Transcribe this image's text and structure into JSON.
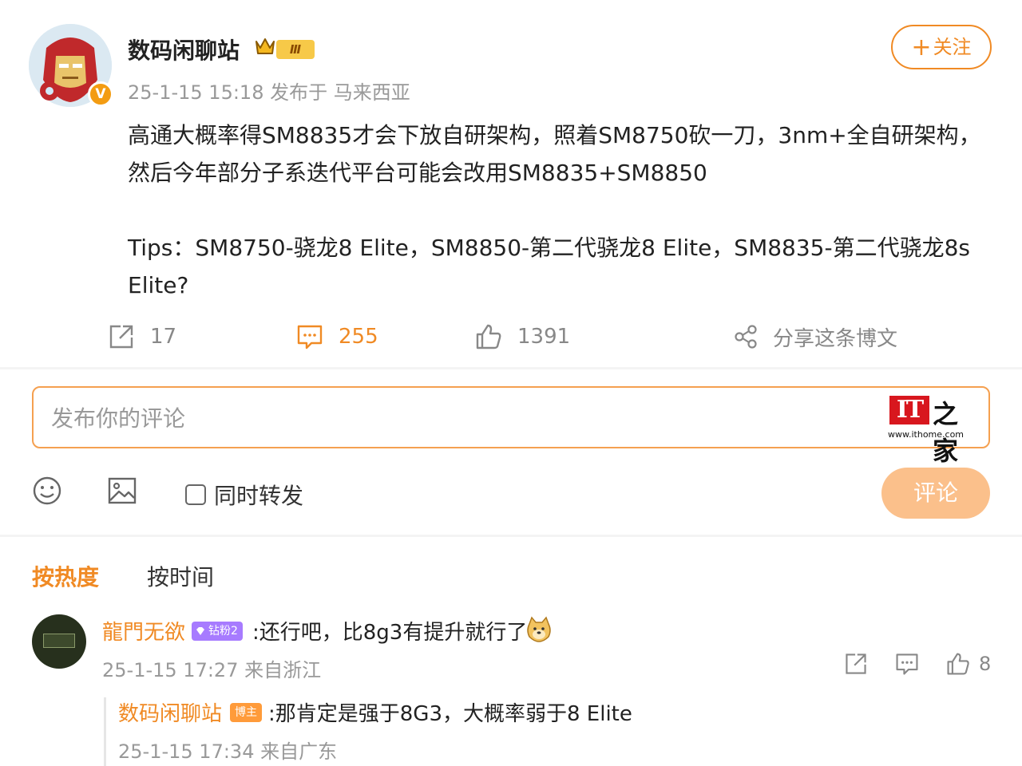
{
  "post": {
    "author": "数码闲聊站",
    "level_badge": "Ⅲ",
    "verified_badge": "V",
    "meta": "25-1-15 15:18 发布于 马来西亚",
    "follow_label": "关注",
    "paragraphs": [
      "高通大概率得SM8835才会下放自研架构，照着SM8750砍一刀，3nm+全自研架构，然后今年部分子系迭代平台可能会改用SM8835+SM8850",
      "Tips：SM8750-骁龙8 Elite，SM8850-第二代骁龙8 Elite，SM8835-第二代骁龙8s Elite?"
    ],
    "actions": {
      "repost_count": "17",
      "comment_count": "255",
      "like_count": "1391",
      "share_label": "分享这条博文"
    }
  },
  "composer": {
    "placeholder": "发布你的评论",
    "repost_option": "同时转发",
    "submit_label": "评论",
    "watermark": {
      "logo_text": "IT",
      "logo_suffix": "之家",
      "url": "www.ithome.com"
    }
  },
  "sort_tabs": [
    "按热度",
    "按时间"
  ],
  "comments": [
    {
      "author": "龍門无欲",
      "badge": "钻粉2",
      "text": ":还行吧，比8g3有提升就行了",
      "meta": "25-1-15 17:27 来自浙江",
      "like_count": "8",
      "reply": {
        "author": "数码闲聊站",
        "badge": "博主",
        "text": ":那肯定是强于8G3，大概率弱于8 Elite",
        "meta": "25-1-15 17:34 来自广东"
      }
    }
  ],
  "colors": {
    "accent": "#f08a24",
    "submit_disabled": "#fbc08b",
    "meta_text": "#999999"
  },
  "icons": [
    "crown-icon",
    "repost-icon",
    "comment-icon",
    "like-icon",
    "share-icon",
    "emoji-icon",
    "image-icon",
    "doge-icon"
  ]
}
